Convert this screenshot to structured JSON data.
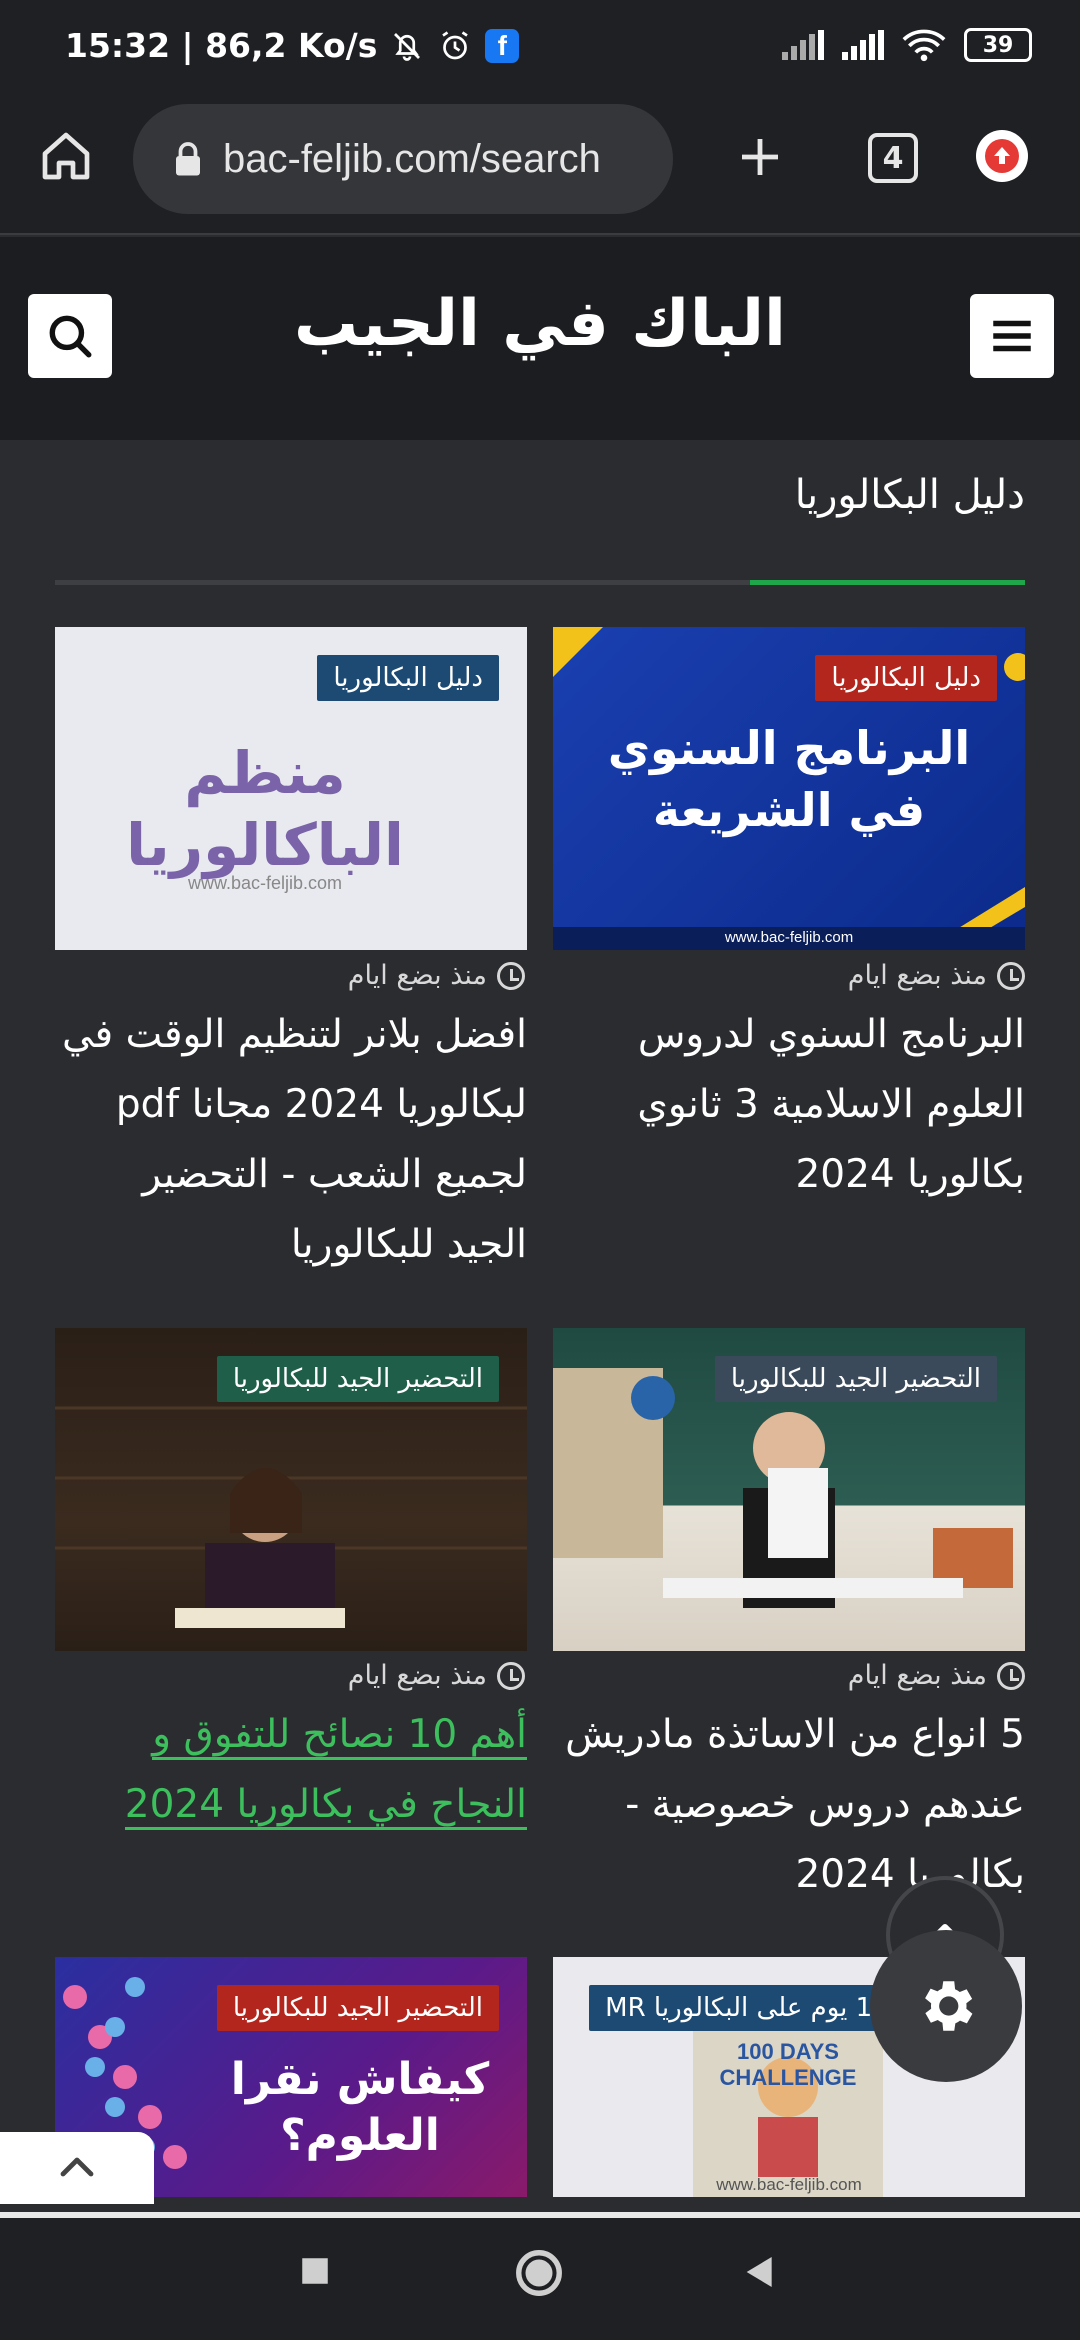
{
  "status": {
    "time_speed": "15:32 | 86,2 Ko/s",
    "battery": "39",
    "fb_letter": "f"
  },
  "browser": {
    "url": "bac-feljib.com/search",
    "tab_count": "4"
  },
  "site": {
    "title": "الباك في الجيب"
  },
  "section": {
    "title": "دليل البكالوريا"
  },
  "cards": [
    {
      "category": "دليل البكالوريا",
      "image_text": "البرنامج السنوي في الشريعة",
      "image_footer": "www.bac-feljib.com",
      "time": "منذ بضع ايام",
      "title": "البرنامج السنوي لدروس العلوم الاسلامية 3 ثانوي بكالوريا 2024"
    },
    {
      "category": "دليل البكالوريا",
      "image_text": "منظم الباكالوريا",
      "image_footer": "www.bac-feljib.com",
      "time": "منذ بضع ايام",
      "title": "افضل بلانر لتنظيم الوقت في لبكالوريا 2024 مجانا pdf لجميع الشعب - التحضير الجيد للبكالوريا"
    },
    {
      "category": "التحضير الجيد للبكالوريا",
      "time": "منذ بضع ايام",
      "title": "5 انواع من الاساتذة مادريش عندهم دروس خصوصية - بكالوريا 2024"
    },
    {
      "category": "التحضير الجيد للبكالوريا",
      "time": "منذ بضع ايام",
      "title": "أهم 10 نصائح للتفوق و النجاح في بكالوريا 2024"
    },
    {
      "category": "برنامج 100 يوم على البكالوريا MR",
      "image_text": "100 DAYS CHALLENGE",
      "image_footer": "www.bac-feljib.com"
    },
    {
      "category": "التحضير الجيد للبكالوريا",
      "image_text": "كيفاش نقرا العلوم؟"
    }
  ],
  "colors": {
    "accent": "#1fa64a",
    "link": "#3cbf5c",
    "badge_red": "#b3261e",
    "badge_blue": "#1d4a73",
    "badge_teal": "#1f5f4a",
    "badge_slate": "#3a4a5a"
  }
}
